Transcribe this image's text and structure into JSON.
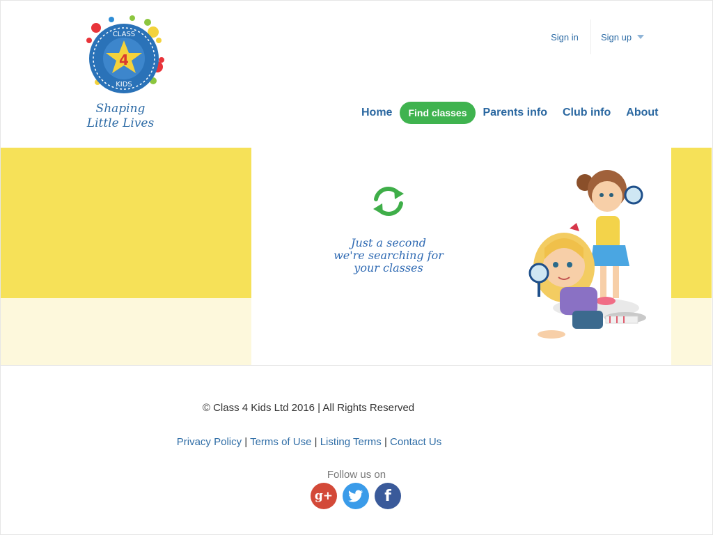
{
  "brand": {
    "logo_text_top": "CLASS",
    "logo_number": "4",
    "logo_text_bottom": "KIDS",
    "tagline_line1": "Shaping",
    "tagline_line2": "Little Lives"
  },
  "header": {
    "sign_in": "Sign in",
    "sign_up": "Sign up"
  },
  "nav": {
    "home": "Home",
    "find_classes": "Find classes",
    "parents_info": "Parents info",
    "club_info": "Club info",
    "about": "About"
  },
  "hero": {
    "message_line1": "Just a second",
    "message_line2": "we're searching for",
    "message_line3": "your classes"
  },
  "footer": {
    "copyright": "© Class 4 Kids Ltd 2016 | All Rights Reserved",
    "privacy": "Privacy Policy",
    "terms": "Terms of Use",
    "listing": "Listing Terms",
    "contact": "Contact Us",
    "separator": "|",
    "follow": "Follow us on"
  },
  "social": {
    "google_plus_glyph": "g+",
    "twitter_icon": "twitter-icon",
    "facebook_glyph": "f"
  },
  "colors": {
    "brand_blue": "#2a67a0",
    "accent_green": "#3fb34f",
    "hero_yellow": "#f6e158",
    "hero_pale": "#fdf8dc"
  }
}
